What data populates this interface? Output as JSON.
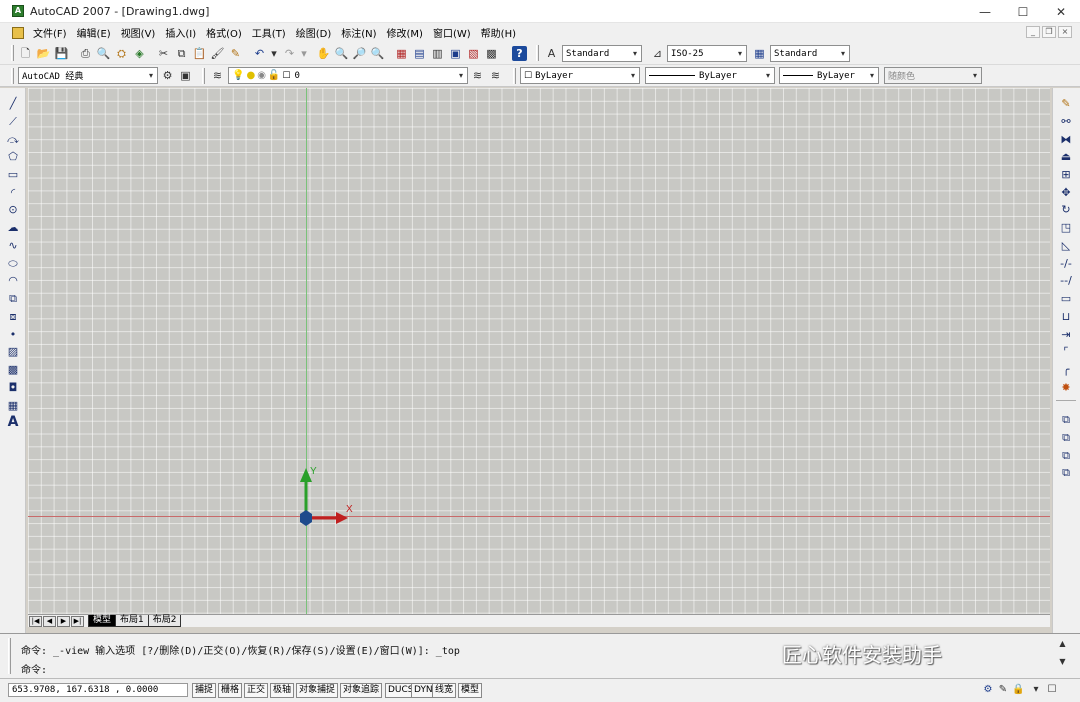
{
  "window": {
    "title": "AutoCAD 2007 - [Drawing1.dwg]",
    "minimize": "—",
    "maximize": "☐",
    "close": "✕"
  },
  "menu": [
    "文件(F)",
    "编辑(E)",
    "视图(V)",
    "插入(I)",
    "格式(O)",
    "工具(T)",
    "绘图(D)",
    "标注(N)",
    "修改(M)",
    "窗口(W)",
    "帮助(H)"
  ],
  "toolbar1": {
    "icons": [
      "new-icon",
      "open-icon",
      "save-icon",
      "plot-icon",
      "plot-preview-icon",
      "publish-icon",
      "3d-dwf-icon",
      "cut-icon",
      "copy-icon",
      "paste-icon",
      "match-properties-icon",
      "block-editor-icon",
      "undo-icon",
      "redo-icon",
      "pan-icon",
      "zoom-realtime-icon",
      "zoom-window-icon",
      "zoom-previous-icon",
      "properties-icon",
      "design-center-icon",
      "tool-palettes-icon",
      "sheet-set-icon",
      "markup-icon",
      "quickcalc-icon",
      "help-icon"
    ],
    "text_style": "Standard",
    "dim_style": "ISO-25",
    "table_style": "Standard"
  },
  "toolbar2": {
    "workspace": "AutoCAD 经典",
    "layer": "0",
    "color": "ByLayer",
    "linetype": "ByLayer",
    "lineweight": "ByLayer",
    "plotstyle": "随颜色"
  },
  "draw_tools": [
    "line-icon",
    "construction-line-icon",
    "polyline-icon",
    "polygon-icon",
    "rectangle-icon",
    "arc-icon",
    "circle-icon",
    "revision-cloud-icon",
    "spline-icon",
    "ellipse-icon",
    "ellipse-arc-icon",
    "insert-block-icon",
    "make-block-icon",
    "point-icon",
    "hatch-icon",
    "gradient-icon",
    "region-icon",
    "table-icon",
    "mtext-icon"
  ],
  "modify_tools": [
    "erase-icon",
    "copy-object-icon",
    "mirror-icon",
    "offset-icon",
    "array-icon",
    "move-icon",
    "rotate-icon",
    "scale-icon",
    "stretch-icon",
    "trim-icon",
    "extend-icon",
    "break-at-point-icon",
    "break-icon",
    "join-icon",
    "chamfer-icon",
    "fillet-icon",
    "explode-icon"
  ],
  "draworder_tools": [
    "bring-to-front-icon",
    "send-to-back-icon",
    "bring-above-icon",
    "send-under-icon"
  ],
  "ucs": {
    "x": "X",
    "y": "Y"
  },
  "layout_tabs": [
    "模型",
    "布局1",
    "布局2"
  ],
  "command": {
    "history": "命令: _-view 输入选项 [?/删除(D)/正交(O)/恢复(R)/保存(S)/设置(E)/窗口(W)]: _top",
    "prompt": "命令:",
    "watermark": "匠心软件安装助手"
  },
  "status": {
    "coords": "653.9708,  167.6318 , 0.0000",
    "toggles": [
      "捕捉",
      "栅格",
      "正交",
      "极轴",
      "对象捕捉",
      "对象追踪",
      "DUCS",
      "DYN",
      "线宽",
      "模型"
    ]
  }
}
